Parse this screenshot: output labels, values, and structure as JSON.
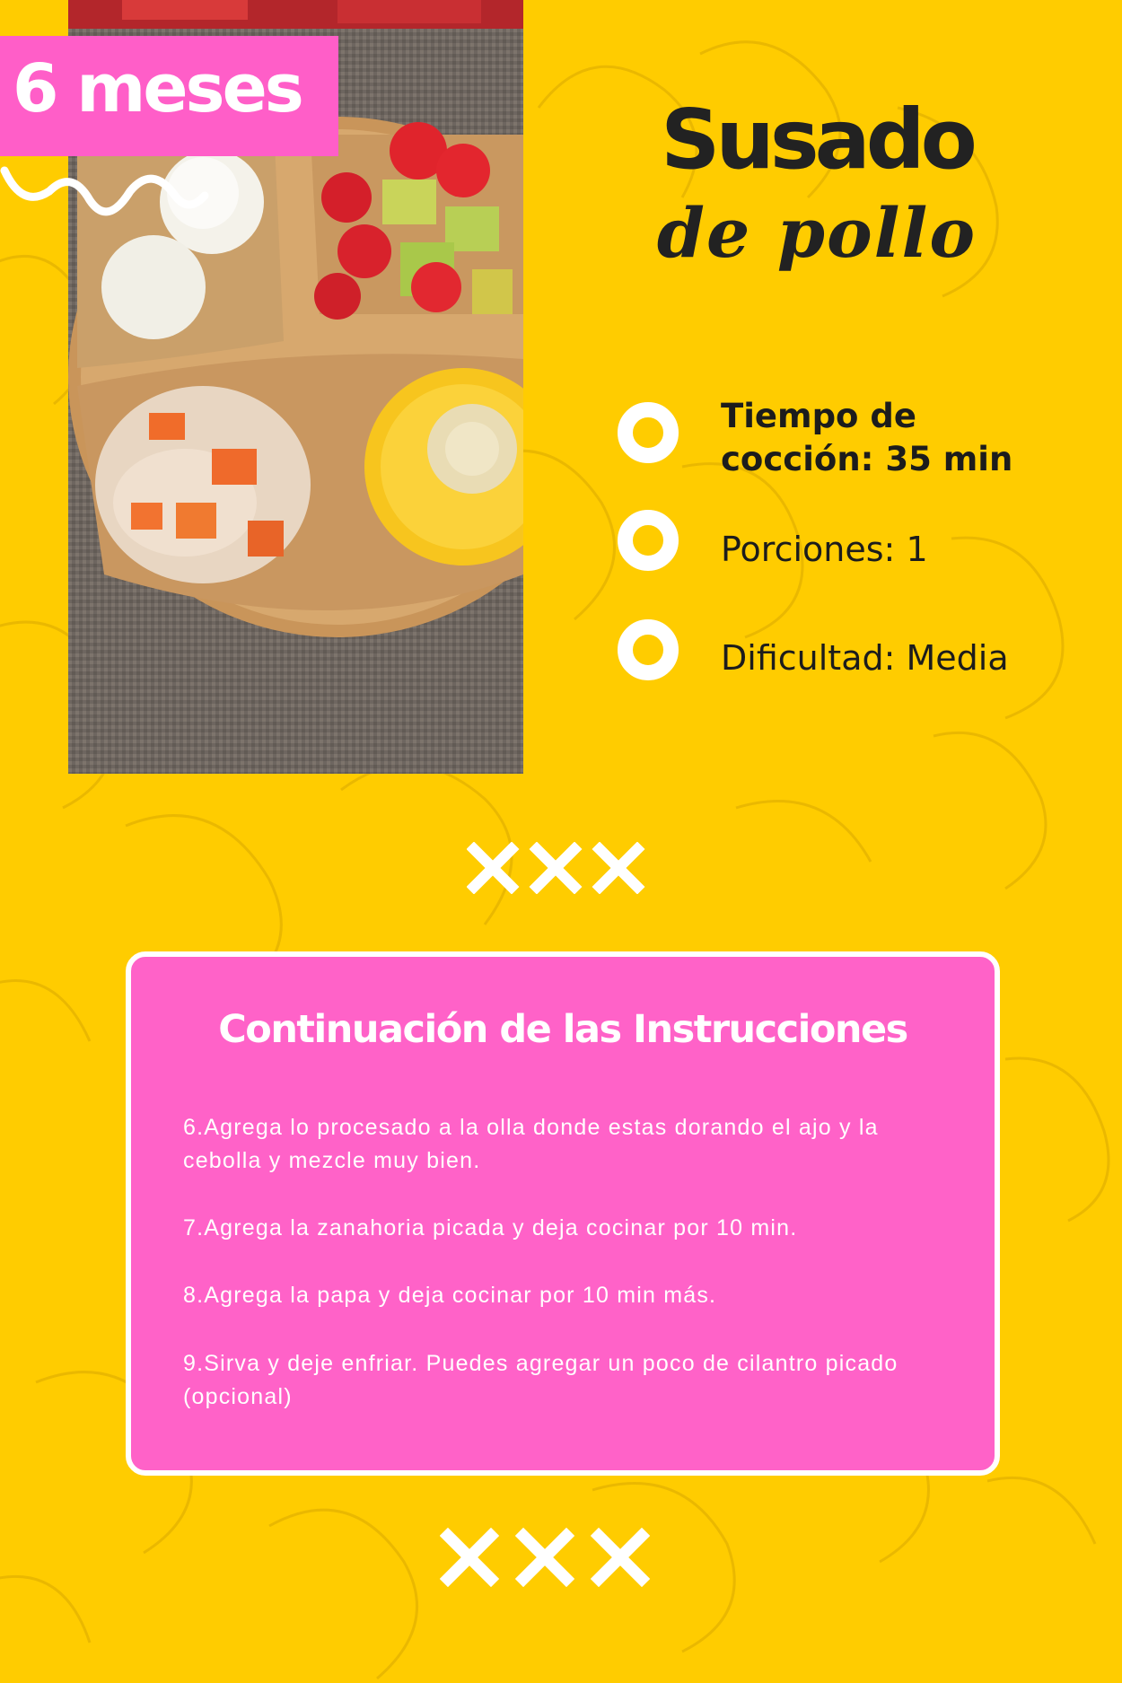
{
  "age_badge": {
    "label": "6 meses"
  },
  "title": {
    "main": "Susado",
    "sub": "de pollo"
  },
  "details": [
    {
      "text": "Tiempo de cocción: 35 min",
      "line1": "Tiempo de",
      "line2": "cocción: 35 min",
      "icon": "ring-bullet-icon"
    },
    {
      "text": "Porciones: 1",
      "icon": "ring-bullet-icon"
    },
    {
      "text": "Dificultad: Media",
      "icon": "ring-bullet-icon"
    }
  ],
  "instructions": {
    "heading": "Continuación de las Instrucciones",
    "steps": [
      "6.Agrega lo procesado a la olla donde estas dorando el ajo y la cebolla y mezcle muy bien.",
      "7.Agrega la zanahoria picada y deja cocinar por 10 min.",
      "8.Agrega la papa y deja cocinar por 10 min más.",
      "9.Sirva y deje enfriar. Puedes agregar un poco de cilantro picado (opcional)"
    ]
  },
  "colors": {
    "background": "#ffcc00",
    "accent_pink": "#ff5ec8",
    "card_pink": "#ff62c8",
    "text_dark": "#1c1c1c",
    "white": "#ffffff"
  }
}
